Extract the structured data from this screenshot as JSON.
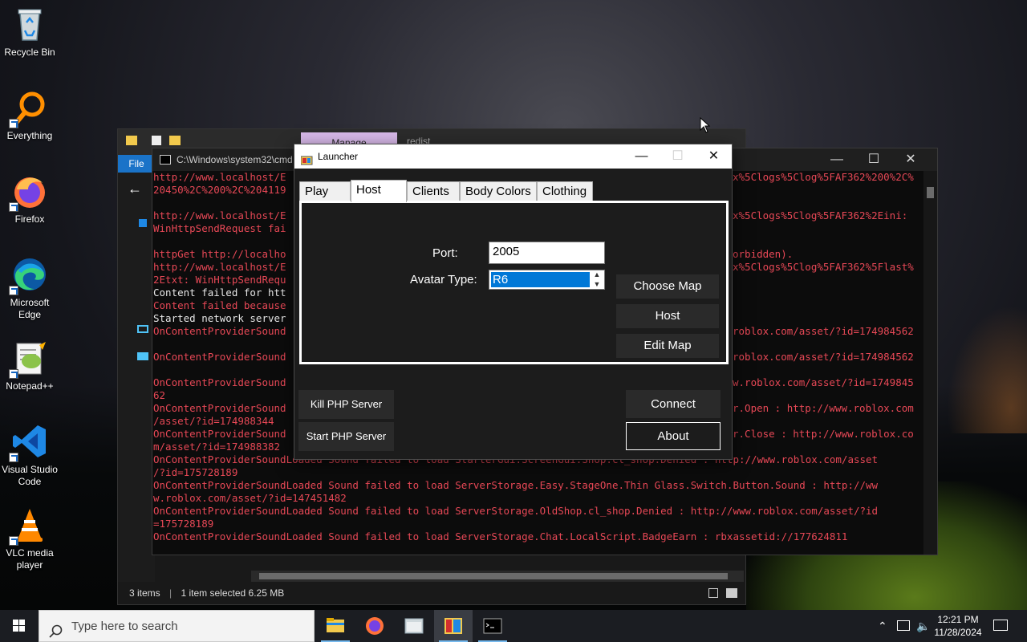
{
  "desktop": {
    "icons": [
      {
        "label": "Recycle Bin"
      },
      {
        "label": "Everything"
      },
      {
        "label": "Firefox"
      },
      {
        "label": "Microsoft Edge"
      },
      {
        "label": "Notepad++"
      },
      {
        "label": "Visual Studio Code"
      },
      {
        "label": "VLC media player"
      }
    ]
  },
  "explorer": {
    "path_hint": "C:\\Windows\\system32\\cmd",
    "manage_tab": "Manage",
    "redist": "redist",
    "file_menu": "File",
    "status": {
      "items": "3 items",
      "selected": "1 item selected  6.25 MB"
    }
  },
  "console": {
    "title": "C:\\Windows\\system32\\cmd",
    "lines": [
      {
        "t": "http://www.localhost/E",
        "c": "r"
      },
      {
        "t": "20450%2C%200%2C%204119",
        "c": "r"
      },
      {
        "t": "",
        "c": "r"
      },
      {
        "t": "http://www.localhost/E",
        "c": "r"
      },
      {
        "t": "WinHttpSendRequest fai",
        "c": "r"
      },
      {
        "t": "",
        "c": "r"
      },
      {
        "t": "httpGet http://localho",
        "c": "r"
      },
      {
        "t": "http://www.localhost/E",
        "c": "r"
      },
      {
        "t": "2Etxt: WinHttpSendRequ",
        "c": "r"
      },
      {
        "t": "Content failed for htt",
        "c": "w"
      },
      {
        "t": "Content failed because",
        "c": "r"
      },
      {
        "t": "Started network server",
        "c": "w"
      },
      {
        "t": "OnContentProviderSound",
        "c": "r"
      },
      {
        "t": "",
        "c": "r"
      },
      {
        "t": "OnContentProviderSound",
        "c": "r"
      },
      {
        "t": "",
        "c": "r"
      },
      {
        "t": "OnContentProviderSound",
        "c": "r"
      },
      {
        "t": "62",
        "c": "r"
      },
      {
        "t": "OnContentProviderSound",
        "c": "r"
      },
      {
        "t": "/asset/?id=174988344",
        "c": "r"
      },
      {
        "t": "OnContentProviderSound",
        "c": "r"
      },
      {
        "t": "m/asset/?id=174988382",
        "c": "r"
      },
      {
        "t": "OnContentProviderSoundLoaded Sound failed to load StarterGui.ScreenGui.Shop.cl_shop.Denied : http://www.roblox.com/asset",
        "c": "r"
      },
      {
        "t": "/?id=175728189",
        "c": "r"
      },
      {
        "t": "OnContentProviderSoundLoaded Sound failed to load ServerStorage.Easy.StageOne.Thin Glass.Switch.Button.Sound : http://ww",
        "c": "r"
      },
      {
        "t": "w.roblox.com/asset/?id=147451482",
        "c": "r"
      },
      {
        "t": "OnContentProviderSoundLoaded Sound failed to load ServerStorage.OldShop.cl_shop.Denied : http://www.roblox.com/asset/?id",
        "c": "r"
      },
      {
        "t": "=175728189",
        "c": "r"
      },
      {
        "t": "OnContentProviderSoundLoaded Sound failed to load ServerStorage.Chat.LocalScript.BadgeEarn : rbxassetid://177624811",
        "c": "r"
      }
    ],
    "right_fragments": [
      {
        "t": "x%5Clogs%5Clog%5FAF362%200%2C%",
        "line": 0
      },
      {
        "t": "x%5Clogs%5Clog%5FAF362%2Eini:",
        "line": 3
      },
      {
        "t": "orbidden).",
        "line": 6
      },
      {
        "t": "x%5Clogs%5Clog%5FAF362%5Flast%",
        "line": 7
      },
      {
        "t": "roblox.com/asset/?id=174984562",
        "line": 12
      },
      {
        "t": "roblox.com/asset/?id=174984562",
        "line": 14
      },
      {
        "t": "w.roblox.com/asset/?id=1749845",
        "line": 16
      },
      {
        "t": "r.Open : http://www.roblox.com",
        "line": 18
      },
      {
        "t": "r.Close : http://www.roblox.co",
        "line": 20
      }
    ]
  },
  "launcher": {
    "title": "Launcher",
    "tabs": [
      {
        "label": "Play"
      },
      {
        "label": "Host"
      },
      {
        "label": "Clients"
      },
      {
        "label": "Body Colors"
      },
      {
        "label": "Clothing"
      }
    ],
    "active_tab": "Host",
    "host": {
      "port_label": "Port:",
      "port_value": "2005",
      "avatar_label": "Avatar Type:",
      "avatar_value": "R6",
      "choose_map": "Choose Map",
      "host": "Host",
      "edit_map": "Edit Map"
    },
    "kill_php": "Kill PHP Server",
    "start_php": "Start PHP Server",
    "connect": "Connect",
    "about": "About"
  },
  "taskbar": {
    "search_placeholder": "Type here to search",
    "time": "12:21 PM",
    "date": "11/28/2024"
  },
  "colors": {
    "console_red": "#e74856",
    "accent_blue": "#0078d7"
  }
}
